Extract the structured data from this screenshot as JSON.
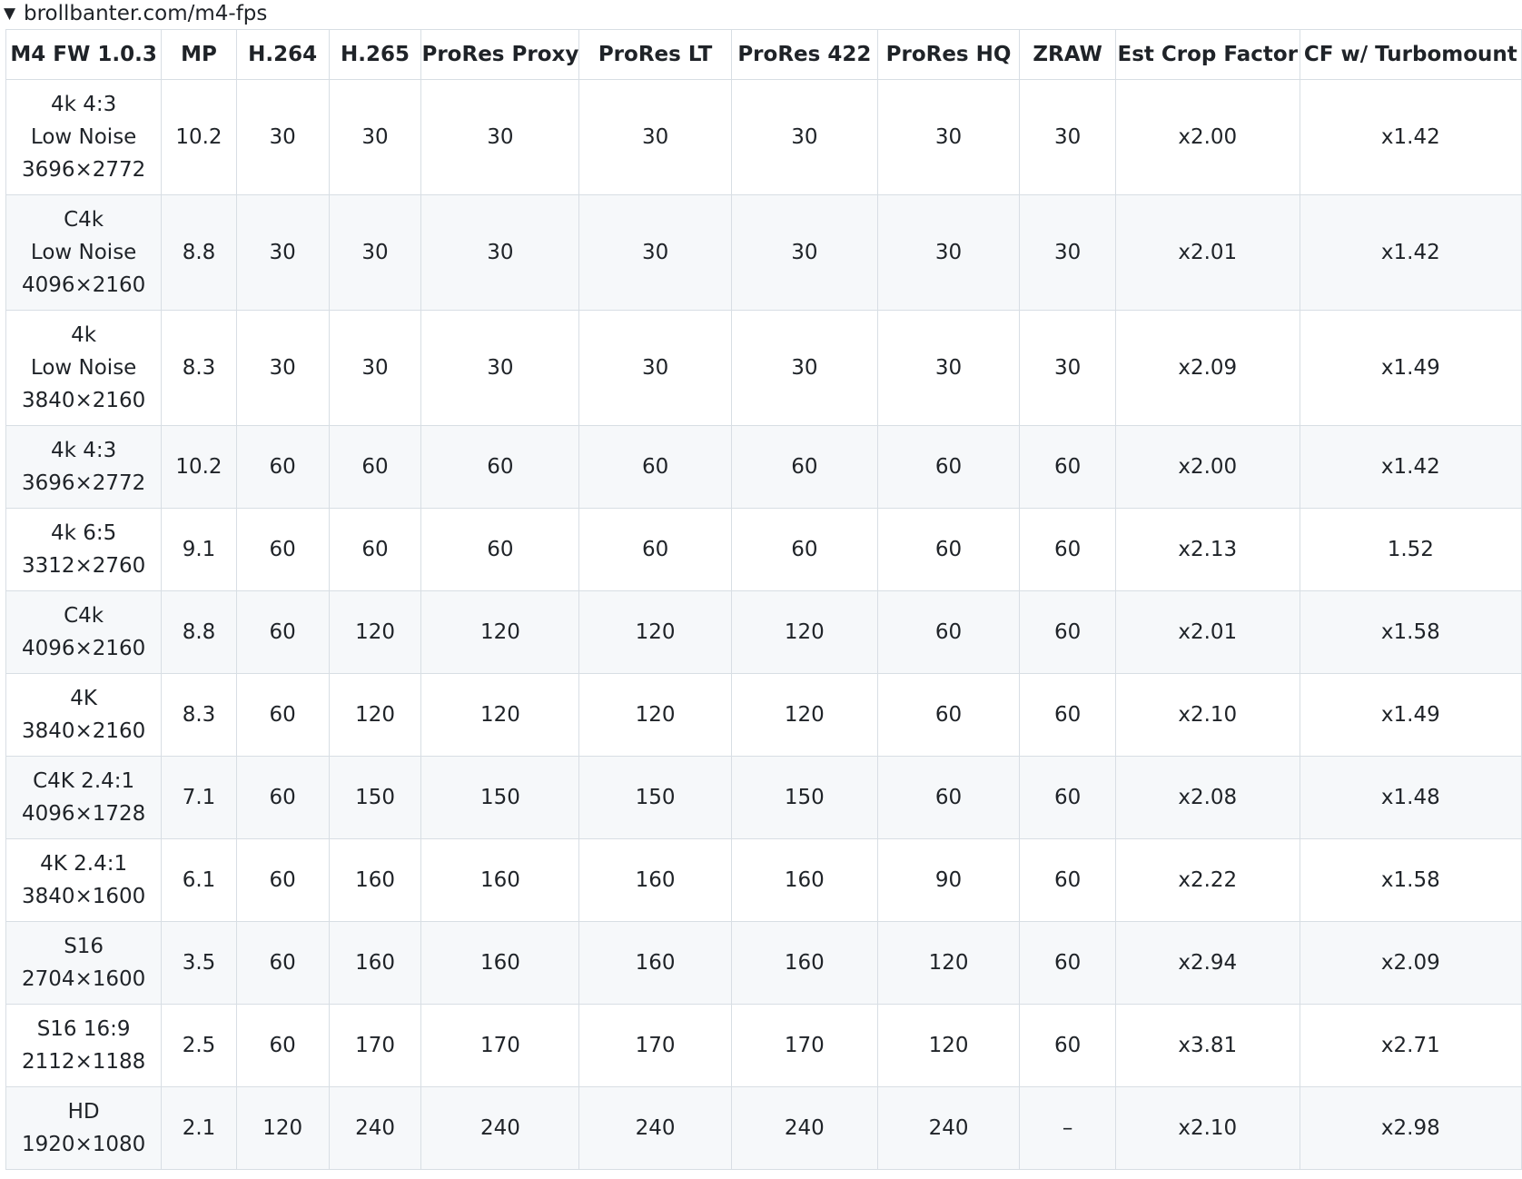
{
  "summary": {
    "marker": "▼",
    "label": "brollbanter.com/m4-fps"
  },
  "table": {
    "headers": [
      "M4 FW 1.0.3",
      "MP",
      "H.264",
      "H.265",
      "ProRes Proxy",
      "ProRes LT",
      "ProRes 422",
      "ProRes HQ",
      "ZRAW",
      "Est Crop Factor",
      "CF w/ Turbomount"
    ],
    "rows": [
      {
        "mode": [
          "4k 4:3",
          "Low Noise",
          "3696×2772"
        ],
        "cells": [
          "10.2",
          "30",
          "30",
          "30",
          "30",
          "30",
          "30",
          "30",
          "x2.00",
          "x1.42"
        ]
      },
      {
        "mode": [
          "C4k",
          "Low Noise",
          "4096×2160"
        ],
        "cells": [
          "8.8",
          "30",
          "30",
          "30",
          "30",
          "30",
          "30",
          "30",
          "x2.01",
          "x1.42"
        ]
      },
      {
        "mode": [
          "4k",
          "Low Noise",
          "3840×2160"
        ],
        "cells": [
          "8.3",
          "30",
          "30",
          "30",
          "30",
          "30",
          "30",
          "30",
          "x2.09",
          "x1.49"
        ]
      },
      {
        "mode": [
          "4k 4:3",
          "3696×2772"
        ],
        "cells": [
          "10.2",
          "60",
          "60",
          "60",
          "60",
          "60",
          "60",
          "60",
          "x2.00",
          "x1.42"
        ]
      },
      {
        "mode": [
          "4k 6:5",
          "3312×2760"
        ],
        "cells": [
          "9.1",
          "60",
          "60",
          "60",
          "60",
          "60",
          "60",
          "60",
          "x2.13",
          "1.52"
        ]
      },
      {
        "mode": [
          "C4k",
          "4096×2160"
        ],
        "cells": [
          "8.8",
          "60",
          "120",
          "120",
          "120",
          "120",
          "60",
          "60",
          "x2.01",
          "x1.58"
        ]
      },
      {
        "mode": [
          "4K",
          "3840×2160"
        ],
        "cells": [
          "8.3",
          "60",
          "120",
          "120",
          "120",
          "120",
          "60",
          "60",
          "x2.10",
          "x1.49"
        ]
      },
      {
        "mode": [
          "C4K 2.4:1",
          "4096×1728"
        ],
        "cells": [
          "7.1",
          "60",
          "150",
          "150",
          "150",
          "150",
          "60",
          "60",
          "x2.08",
          "x1.48"
        ]
      },
      {
        "mode": [
          "4K 2.4:1",
          "3840×1600"
        ],
        "cells": [
          "6.1",
          "60",
          "160",
          "160",
          "160",
          "160",
          "90",
          "60",
          "x2.22",
          "x1.58"
        ]
      },
      {
        "mode": [
          "S16",
          "2704×1600"
        ],
        "cells": [
          "3.5",
          "60",
          "160",
          "160",
          "160",
          "160",
          "120",
          "60",
          "x2.94",
          "x2.09"
        ]
      },
      {
        "mode": [
          "S16 16:9",
          "2112×1188"
        ],
        "cells": [
          "2.5",
          "60",
          "170",
          "170",
          "170",
          "170",
          "120",
          "60",
          "x3.81",
          "x2.71"
        ]
      },
      {
        "mode": [
          "HD",
          "1920×1080"
        ],
        "cells": [
          "2.1",
          "120",
          "240",
          "240",
          "240",
          "240",
          "240",
          "–",
          "x2.10",
          "x2.98"
        ]
      }
    ]
  }
}
